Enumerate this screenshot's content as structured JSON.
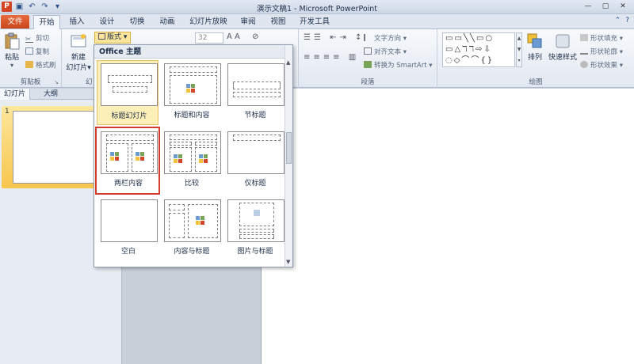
{
  "window": {
    "app_icon": "P",
    "title": "演示文稿1 - Microsoft PowerPoint",
    "controls": [
      "—",
      "▢",
      "✕"
    ]
  },
  "quick_access": [
    "save-icon",
    "undo-icon",
    "redo-icon",
    "customize-icon"
  ],
  "tabs": {
    "file": "文件",
    "items": [
      "开始",
      "插入",
      "设计",
      "切换",
      "动画",
      "幻灯片放映",
      "审阅",
      "视图",
      "开发工具"
    ],
    "active": "开始"
  },
  "ribbon": {
    "clipboard": {
      "label": "剪贴板",
      "paste": "粘贴",
      "cut": "剪切",
      "copy": "复制",
      "format_painter": "格式刷"
    },
    "slides": {
      "label": "幻",
      "new_slide": "新建",
      "new_slide_line2": "幻灯片",
      "layout": "版式"
    },
    "font": {
      "size": "32"
    },
    "paragraph": {
      "label": "段落",
      "text_direction": "文字方向",
      "align_text": "对齐文本",
      "convert_smartart": "转换为 SmartArt"
    },
    "drawing": {
      "label": "绘图",
      "arrange": "排列",
      "quick_styles": "快速样式",
      "shape_fill": "形状填充",
      "shape_outline": "形状轮廓",
      "shape_effects": "形状效果",
      "shapes_preview": "▭▭╲╲▭○ ▭△ℸℸ⇨⇩ ◌◇⌒⌒{}"
    }
  },
  "left_panel": {
    "tabs": [
      "幻灯片",
      "大纲"
    ],
    "close": "✕",
    "slide_number": "1"
  },
  "gallery": {
    "header": "Office 主题",
    "items": [
      {
        "name": "标题幻灯片",
        "layout": "title"
      },
      {
        "name": "标题和内容",
        "layout": "title-content"
      },
      {
        "name": "节标题",
        "layout": "section"
      },
      {
        "name": "两栏内容",
        "layout": "two-content"
      },
      {
        "name": "比较",
        "layout": "comparison"
      },
      {
        "name": "仅标题",
        "layout": "title-only"
      },
      {
        "name": "空白",
        "layout": "blank"
      },
      {
        "name": "内容与标题",
        "layout": "content-caption"
      },
      {
        "name": "图片与标题",
        "layout": "picture-caption"
      }
    ],
    "hovered": "标题幻灯片",
    "highlighted": "两栏内容"
  },
  "colors": {
    "file_tab": "#d24625",
    "highlight_outline": "#d23d2e",
    "hover": "#fdefb8"
  }
}
